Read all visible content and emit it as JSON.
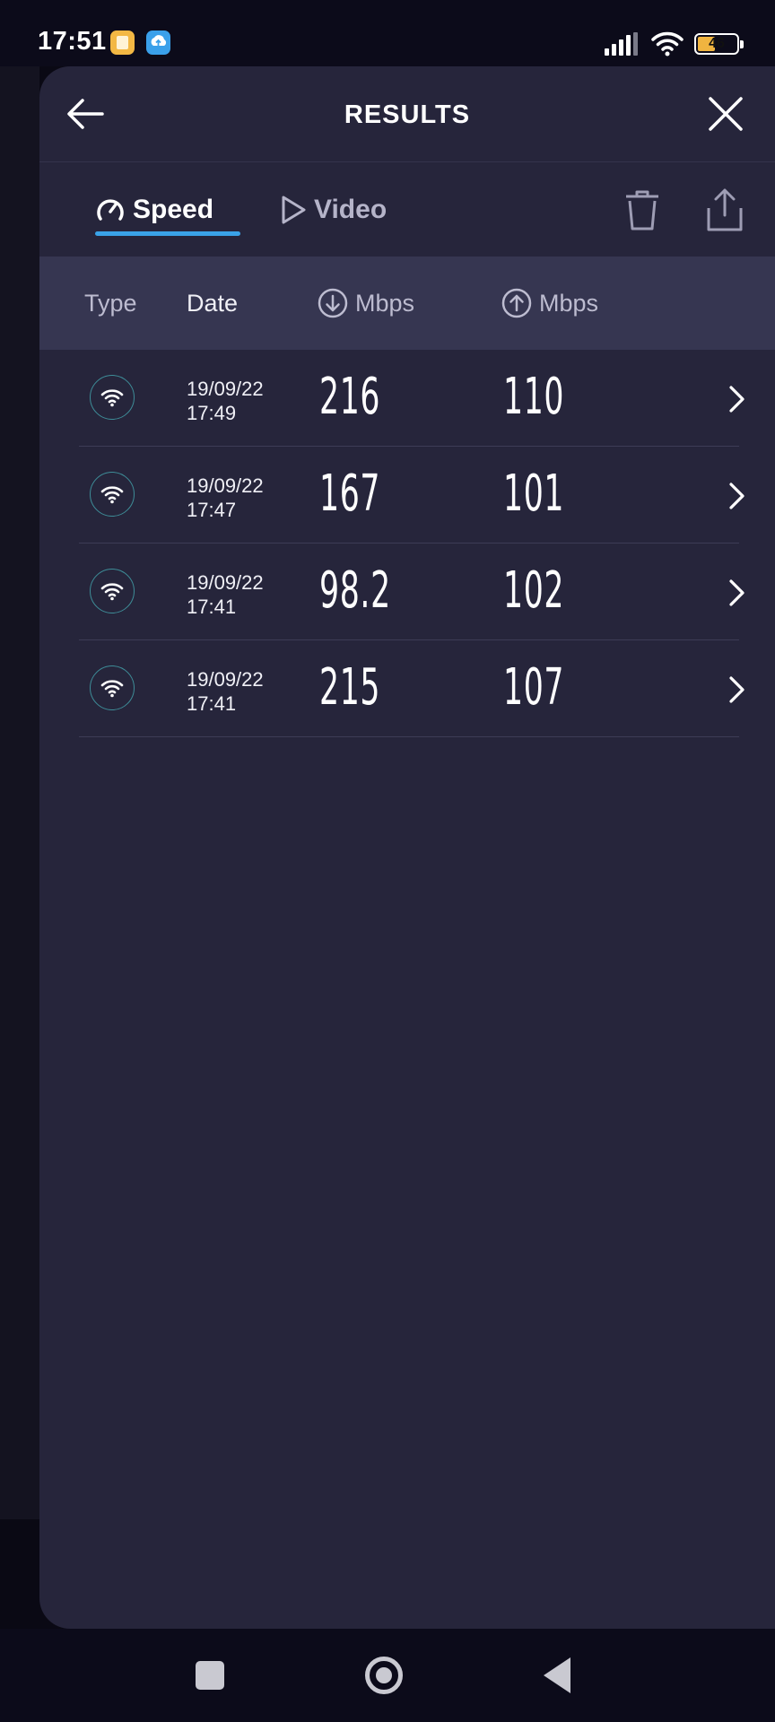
{
  "status_bar": {
    "time": "17:51",
    "battery": "46",
    "battery_level": 0.46,
    "icons": [
      "notes-app-icon",
      "upload-app-icon",
      "signal-icon",
      "wifi-icon",
      "battery-icon"
    ]
  },
  "header": {
    "title": "RESULTS",
    "back_icon": "arrow-left-icon",
    "close_icon": "close-icon"
  },
  "tabs": [
    {
      "label": "Speed",
      "icon": "speedometer-icon",
      "active": true
    },
    {
      "label": "Video",
      "icon": "play-icon",
      "active": false
    }
  ],
  "toolbar": {
    "delete_icon": "trash-icon",
    "share_icon": "share-icon"
  },
  "columns": {
    "type": "Type",
    "date": "Date",
    "download": "Mbps",
    "upload": "Mbps"
  },
  "results": [
    {
      "type": "wifi",
      "date": "19/09/22",
      "time": "17:49",
      "download": "216",
      "upload": "110"
    },
    {
      "type": "wifi",
      "date": "19/09/22",
      "time": "17:47",
      "download": "167",
      "upload": "101"
    },
    {
      "type": "wifi",
      "date": "19/09/22",
      "time": "17:41",
      "download": "98.2",
      "upload": "102"
    },
    {
      "type": "wifi",
      "date": "19/09/22",
      "time": "17:41",
      "download": "215",
      "upload": "107"
    }
  ],
  "colors": {
    "panel": "#26253b",
    "header_row": "#363651",
    "accent": "#3aa3e8",
    "wifi_ring": "#3e8d98"
  }
}
